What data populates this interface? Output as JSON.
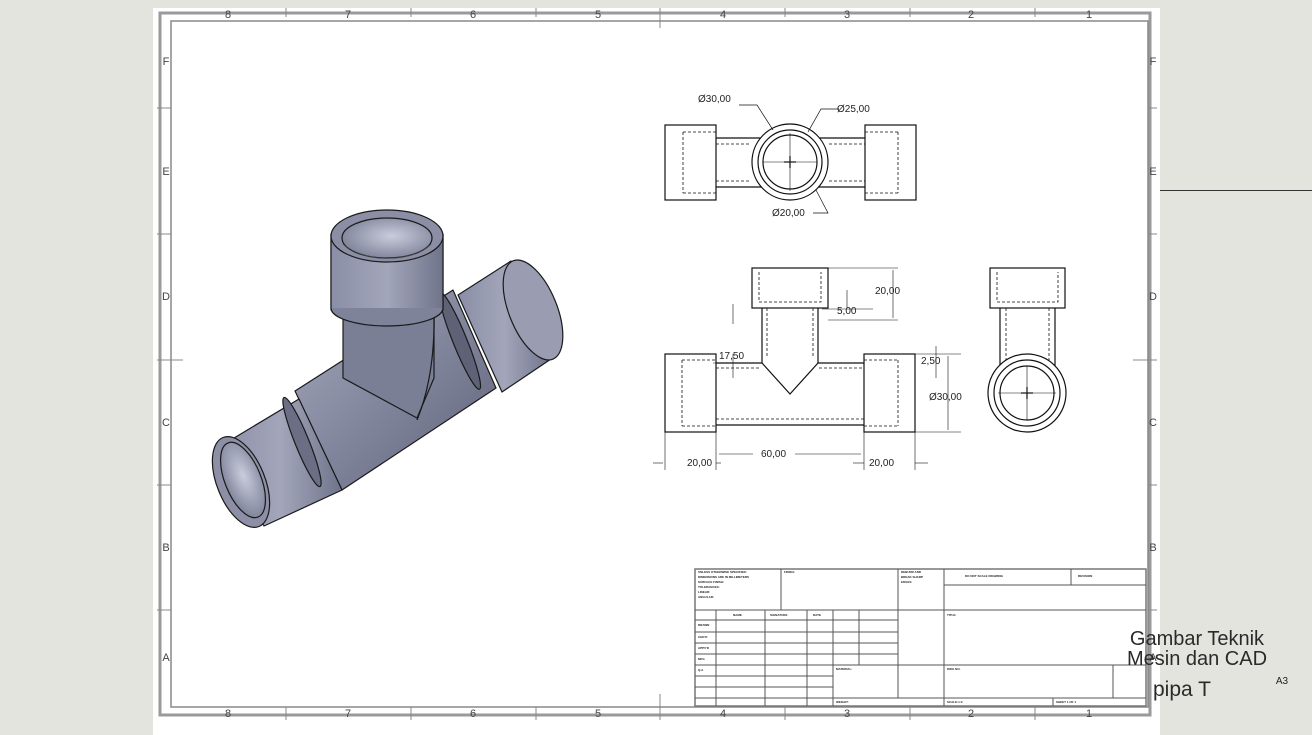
{
  "drawing": {
    "column_labels": [
      "8",
      "7",
      "6",
      "5",
      "4",
      "3",
      "2",
      "1"
    ],
    "row_labels": [
      "F",
      "E",
      "D",
      "C",
      "B",
      "A"
    ],
    "dimensions": {
      "top_outer": "Ø30,00",
      "top_mid": "Ø25,00",
      "top_inner": "Ø20,00",
      "branch_height": "20,00",
      "branch_depth": "5,00",
      "cone": "17,50",
      "side_offset": "2,50",
      "run_diameter": "Ø30,00",
      "left_end": "20,00",
      "center_length": "60,00",
      "right_end": "20,00"
    }
  },
  "title_block": {
    "title_line_1": "Gambar Teknik",
    "title_line_2": "Mesin dan CAD",
    "part_name": "pipa T",
    "sheet_size": "A3",
    "labels": {
      "unless": "UNLESS OTHERWISE SPECIFIED:",
      "dims": "DIMENSIONS ARE IN MILLIMETERS",
      "finish": "SURFACE FINISH:",
      "tol": "TOLERANCES:",
      "linear": "LINEAR:",
      "angular": "ANGULAR:",
      "finish_col": "FINISH:",
      "deburr": "DEBURR AND",
      "break": "BREAK SHARP",
      "edges": "EDGES",
      "do_not_scale": "DO NOT SCALE DRAWING",
      "revision": "REVISION",
      "name": "NAME",
      "signature": "SIGNATURE",
      "date": "DATE",
      "drawn": "DRAWN",
      "chkd": "CHK'D",
      "appvd": "APPV'D",
      "mfg": "MFG",
      "qa": "Q.A",
      "material": "MATERIAL:",
      "weight": "WEIGHT:",
      "title": "TITLE:",
      "dwg_no": "DWG NO.",
      "scale": "SCALE:1:2",
      "sheet": "SHEET 1 OF 1"
    }
  }
}
